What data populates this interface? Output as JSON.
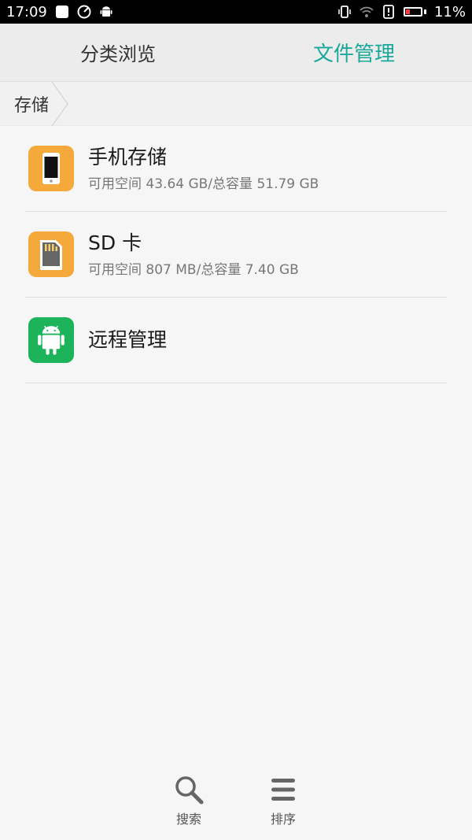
{
  "status_bar": {
    "time": "17:09",
    "battery_percent": "11%",
    "battery_level": 0.11,
    "battery_color": "#ff3b3b",
    "icons": [
      "notification-square-icon",
      "speed-gauge-icon",
      "android-icon",
      "vibrate-icon",
      "wifi-icon",
      "alert-icon",
      "battery-charging-icon"
    ]
  },
  "tabs": [
    {
      "label": "分类浏览",
      "active": false
    },
    {
      "label": "文件管理",
      "active": true
    }
  ],
  "accent_color": "#1aa89a",
  "breadcrumb": {
    "label": "存储"
  },
  "storage_list": [
    {
      "icon": "phone-icon",
      "icon_color": "#f4a93a",
      "title": "手机存储",
      "subtitle": "可用空间 43.64 GB/总容量 51.79 GB"
    },
    {
      "icon": "sd-card-icon",
      "icon_color": "#f4a93a",
      "title": "SD 卡",
      "subtitle": "可用空间 807 MB/总容量 7.40 GB"
    },
    {
      "icon": "android-icon",
      "icon_color": "#1db35b",
      "title": "远程管理",
      "subtitle": ""
    }
  ],
  "bottom_bar": {
    "search_label": "搜索",
    "sort_label": "排序"
  }
}
